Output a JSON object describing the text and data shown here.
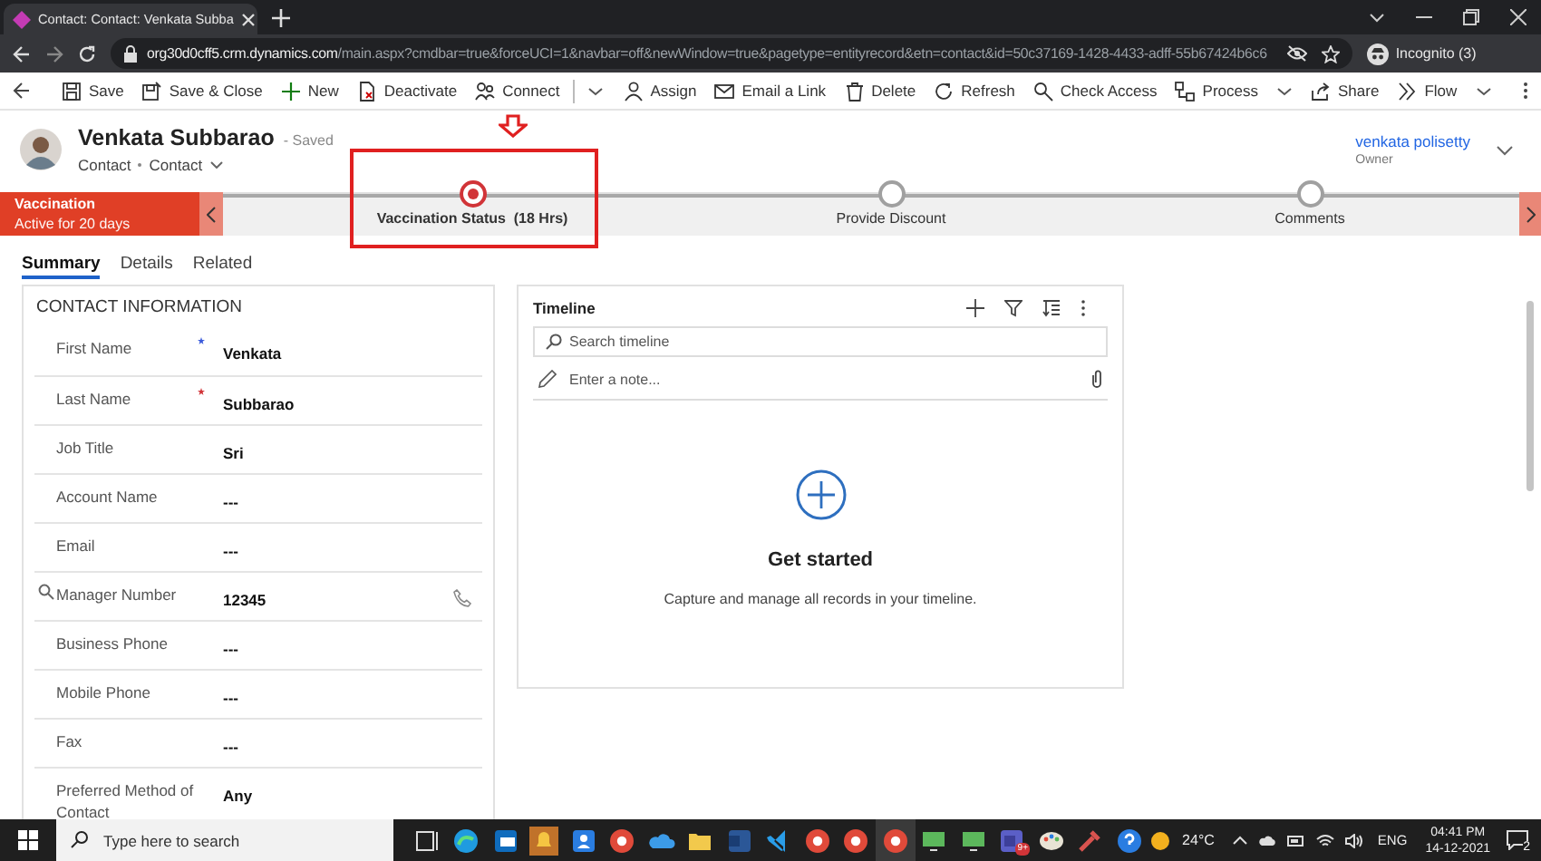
{
  "browser": {
    "tab_title": "Contact: Contact: Venkata Subba",
    "url_host": "org30d0cff5.crm.dynamics.com",
    "url_path": "/main.aspx?cmdbar=true&forceUCI=1&navbar=off&newWindow=true&pagetype=entityrecord&etn=contact&id=50c37169-1428-4433-adff-55b67424b6c6",
    "profile_label": "Incognito (3)"
  },
  "command_bar": [
    {
      "label": "Save",
      "kind": "button"
    },
    {
      "label": "Save & Close",
      "kind": "button"
    },
    {
      "label": "New",
      "kind": "button"
    },
    {
      "label": "Deactivate",
      "kind": "button"
    },
    {
      "label": "Connect",
      "kind": "split"
    },
    {
      "label": "Assign",
      "kind": "button"
    },
    {
      "label": "Email a Link",
      "kind": "button"
    },
    {
      "label": "Delete",
      "kind": "button"
    },
    {
      "label": "Refresh",
      "kind": "button"
    },
    {
      "label": "Check Access",
      "kind": "button"
    },
    {
      "label": "Process",
      "kind": "dropdown"
    },
    {
      "label": "Share",
      "kind": "button"
    },
    {
      "label": "Flow",
      "kind": "dropdown"
    }
  ],
  "record": {
    "name": "Venkata Subbarao",
    "save_status": "- Saved",
    "entity": "Contact",
    "form": "Contact",
    "owner_name": "venkata polisetty",
    "owner_label": "Owner"
  },
  "process": {
    "active_stage": "Vaccination",
    "active_duration": "Active for 20 days",
    "stages": [
      {
        "label": "Vaccination Status  (18 Hrs)",
        "selected": true
      },
      {
        "label": "Provide Discount",
        "selected": false
      },
      {
        "label": "Comments",
        "selected": false
      }
    ]
  },
  "tabs": [
    {
      "label": "Summary",
      "selected": true
    },
    {
      "label": "Details",
      "selected": false
    },
    {
      "label": "Related",
      "selected": false
    }
  ],
  "contact_section": {
    "title": "CONTACT INFORMATION",
    "fields": [
      {
        "label": "First Name",
        "value": "Venkata",
        "required": false,
        "recommended": true,
        "kind": "text"
      },
      {
        "label": "Last Name",
        "value": "Subbarao",
        "required": true,
        "recommended": false,
        "kind": "text"
      },
      {
        "label": "Job Title",
        "value": "Sri",
        "required": false,
        "recommended": false,
        "kind": "text"
      },
      {
        "label": "Account Name",
        "value": "---",
        "required": false,
        "recommended": false,
        "kind": "text"
      },
      {
        "label": "Email",
        "value": "---",
        "required": false,
        "recommended": false,
        "kind": "text"
      },
      {
        "label": "Manager Number",
        "value": "12345",
        "required": false,
        "recommended": false,
        "kind": "phone"
      },
      {
        "label": "Business Phone",
        "value": "---",
        "required": false,
        "recommended": false,
        "kind": "text"
      },
      {
        "label": "Mobile Phone",
        "value": "---",
        "required": false,
        "recommended": false,
        "kind": "text"
      },
      {
        "label": "Fax",
        "value": "---",
        "required": false,
        "recommended": false,
        "kind": "text"
      },
      {
        "label": "Preferred Method of Contact",
        "value": "Any",
        "required": false,
        "recommended": false,
        "kind": "text"
      }
    ]
  },
  "timeline": {
    "title": "Timeline",
    "search_placeholder": "Search timeline",
    "note_placeholder": "Enter a note...",
    "empty_title": "Get started",
    "empty_text": "Capture and manage all records in your timeline."
  },
  "taskbar": {
    "search_placeholder": "Type here to search",
    "app_badge": "9+",
    "temperature": "24°C",
    "language": "ENG",
    "time": "04:41 PM",
    "date": "14-12-2021",
    "notification_count": "2"
  }
}
